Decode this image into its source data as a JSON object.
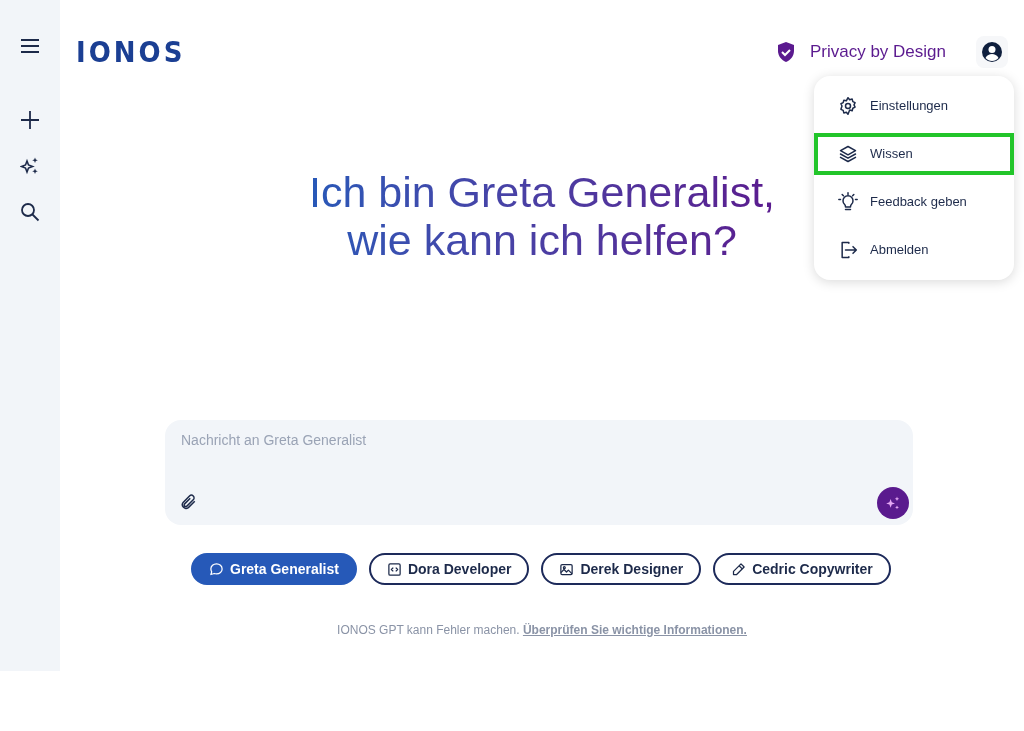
{
  "logo": "IONOS",
  "privacy": "Privacy by Design",
  "menu": [
    {
      "kind": "settings",
      "label": "Einstellungen",
      "highlighted": false
    },
    {
      "kind": "knowledge",
      "label": "Wissen",
      "highlighted": true
    },
    {
      "kind": "feedback",
      "label": "Feedback geben",
      "highlighted": false
    },
    {
      "kind": "logout",
      "label": "Abmelden",
      "highlighted": false
    }
  ],
  "headline": [
    "Ich bin Greta Generalist,",
    "wie kann ich helfen?"
  ],
  "composer": {
    "placeholder": "Nachricht an Greta Generalist"
  },
  "personas": [
    {
      "kind": "chat",
      "label": "Greta Generalist",
      "selected": true
    },
    {
      "kind": "code",
      "label": "Dora Developer",
      "selected": false
    },
    {
      "kind": "image",
      "label": "Derek Designer",
      "selected": false
    },
    {
      "kind": "pen",
      "label": "Cedric Copywriter",
      "selected": false
    }
  ],
  "disclaimer": {
    "text": "IONOS GPT kann Fehler machen.",
    "link": "Überprüfen Sie wichtige Informationen."
  }
}
